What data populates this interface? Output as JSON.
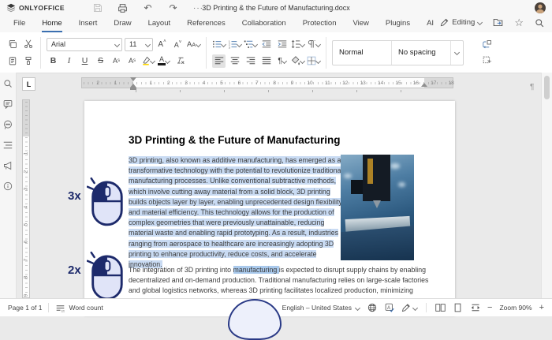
{
  "titlebar": {
    "app_name": "ONLYOFFICE",
    "document_title": "3D Printing & the Future of Manufacturing.docx",
    "more_label": "···"
  },
  "menu": {
    "tabs": [
      "File",
      "Home",
      "Insert",
      "Draw",
      "Layout",
      "References",
      "Collaboration",
      "Protection",
      "View",
      "Plugins",
      "AI"
    ],
    "active_tab": "Home",
    "editing_mode_label": "Editing"
  },
  "toolbar": {
    "font_name": "Arial",
    "font_size": "11",
    "styles": {
      "style1": "Normal",
      "style2": "No spacing"
    },
    "letters": {
      "bold": "B",
      "italic": "I",
      "underline": "U",
      "strike": "S",
      "inc_font": "A",
      "dec_font": "A",
      "change_case": "A",
      "case_small": "A",
      "font_color": "A",
      "sup": "A",
      "sub": "A"
    }
  },
  "ruler": {
    "h_numbers_left": [
      "1",
      "2"
    ],
    "h_numbers_right": [
      "1",
      "2",
      "3",
      "4",
      "5",
      "6",
      "7",
      "8",
      "9",
      "10",
      "11",
      "12",
      "13",
      "14",
      "15",
      "16",
      "17",
      "18"
    ],
    "v_numbers": [
      "1",
      "2",
      "3",
      "4",
      "5",
      "6",
      "7",
      "8",
      "9"
    ],
    "tab_selector": "L"
  },
  "sidebar_icons": [
    "search-icon",
    "comments-icon",
    "chat-icon",
    "navigation-icon",
    "feedback-icon",
    "about-icon"
  ],
  "document": {
    "heading": "3D Printing & the Future of Manufacturing",
    "paragraph1": "3D printing, also known as additive manufacturing, has emerged as a transformative technology with the potential to revolutionize traditional manufacturing processes. Unlike conventional subtractive methods, which involve cutting away material from a solid block, 3D printing builds objects layer by layer, enabling unprecedented design flexibility and material efficiency. This technology allows for the production of complex geometries that were previously unattainable, reducing material waste and enabling rapid prototyping. As a result, industries ranging from aerospace to healthcare are increasingly adopting 3D printing to enhance productivity, reduce costs, and accelerate innovation.",
    "paragraph2_before": "The integration of 3D printing into ",
    "paragraph2_highlight": "manufacturing ",
    "paragraph2_after": "is expected to disrupt supply chains by enabling decentralized and on-demand production. Traditional manufacturing relies on large-scale factories and global logistics networks, whereas 3D printing facilitates localized production, minimizing transportation costs and lead times. This shift could lead to more",
    "annotations": {
      "triple_click_label": "3x",
      "double_click_label": "2x"
    }
  },
  "statusbar": {
    "page_label": "Page 1 of 1",
    "word_count_label": "Word count",
    "language": "English – United States",
    "zoom_label": "Zoom 90%",
    "zoom_out": "−",
    "zoom_in": "+"
  },
  "colors": {
    "accent_blue": "#3b6fb0",
    "selection_blue": "#c9dbf3",
    "word_highlight_blue": "#a9c9ec",
    "annotation_navy": "#1d2a6b",
    "annotation_fill": "#e0e4f8",
    "highlight_yellow": "#ffd800"
  }
}
